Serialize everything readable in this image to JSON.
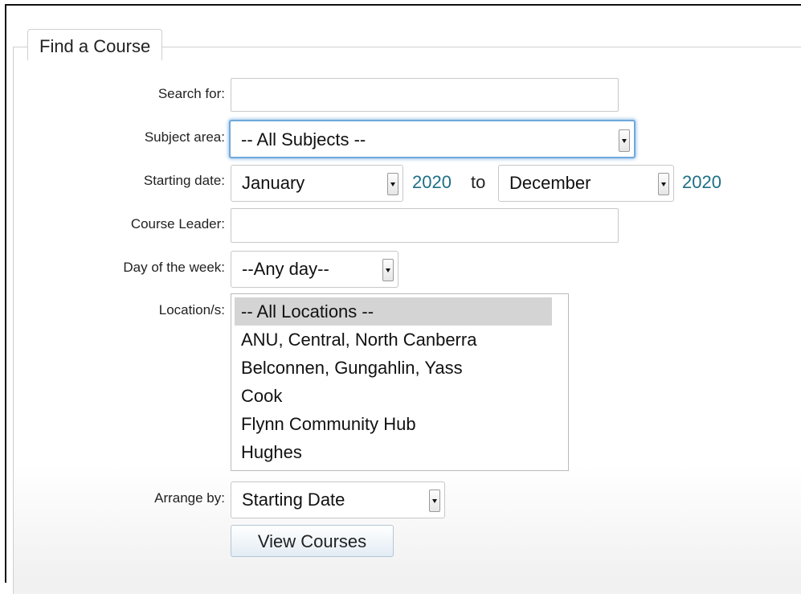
{
  "form": {
    "legend": "Find a Course",
    "search": {
      "label": "Search for:",
      "value": ""
    },
    "subject": {
      "label": "Subject area:",
      "value": "-- All Subjects --"
    },
    "starting_date": {
      "label": "Starting date:",
      "from_month": "January",
      "from_year": "2020",
      "to_text": "to",
      "to_month": "December",
      "to_year": "2020"
    },
    "course_leader": {
      "label": "Course Leader:",
      "value": ""
    },
    "day_of_week": {
      "label": "Day of the week:",
      "value": "--Any day--"
    },
    "locations": {
      "label": "Location/s:",
      "options": [
        "-- All Locations --",
        "ANU, Central, North Canberra",
        "Belconnen, Gungahlin, Yass",
        "Cook",
        "Flynn Community Hub",
        "Hughes"
      ],
      "selected": "-- All Locations --"
    },
    "arrange_by": {
      "label": "Arrange by:",
      "value": "Starting Date"
    },
    "submit_label": "View Courses"
  },
  "colors": {
    "year_link": "#1d6f86",
    "focus_ring": "#6fa8dc",
    "selected_option": "#d4d4d4"
  }
}
